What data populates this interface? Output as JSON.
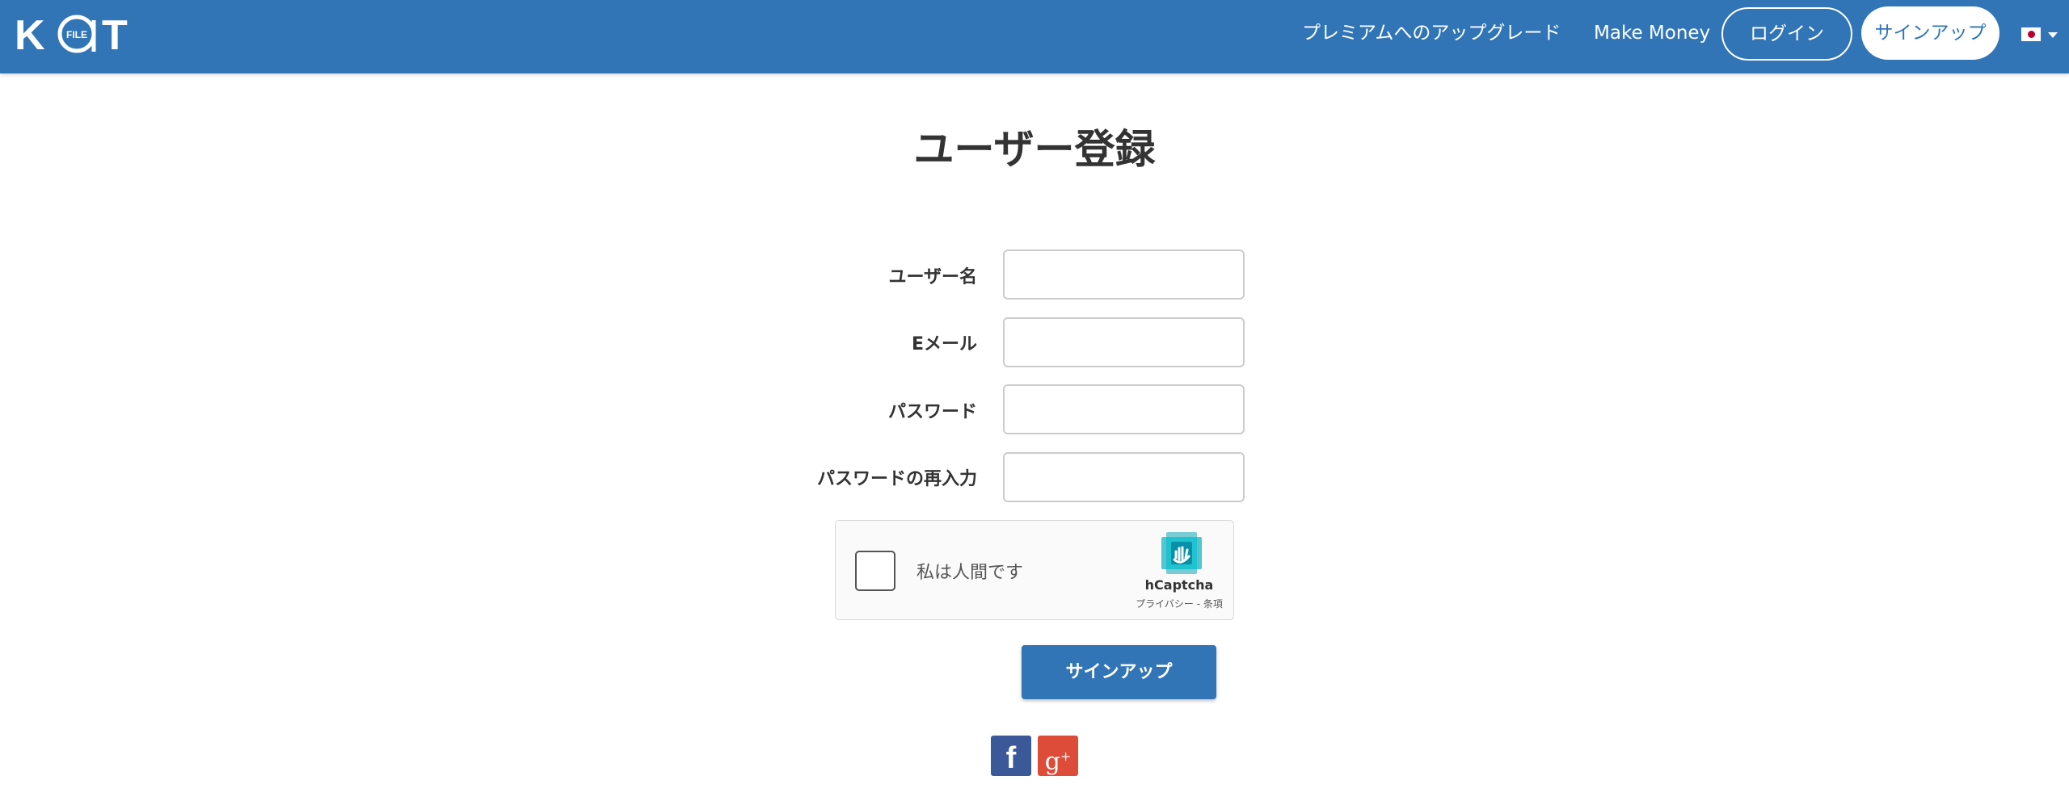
{
  "navbar": {
    "logo_letters": [
      "K",
      "FILE",
      "T"
    ],
    "upgrade_label": "プレミアムへのアップグレード",
    "make_money_label": "Make Money",
    "login_label": "ログイン",
    "signup_label": "サインアップ",
    "language_icon": "japan-flag-icon",
    "colors": {
      "bar": "#3175b7",
      "text": "#ffffff"
    }
  },
  "page": {
    "title": "ユーザー登録"
  },
  "form": {
    "fields": [
      {
        "label": "ユーザー名",
        "value": "",
        "type": "text"
      },
      {
        "label": "Eメール",
        "value": "",
        "type": "email"
      },
      {
        "label": "パスワード",
        "value": "",
        "type": "password"
      },
      {
        "label": "パスワードの再入力",
        "value": "",
        "type": "password"
      }
    ],
    "captcha": {
      "checkbox_label": "私は人間です",
      "brand": "hCaptcha",
      "links": "プライバシー - 条項",
      "checked": false
    },
    "submit_label": "サインアップ",
    "submit_color": "#3175b7"
  },
  "social": {
    "facebook_label": "f",
    "google_plus_label": "g",
    "google_plus_sup": "+",
    "colors": {
      "facebook": "#3b5998",
      "google_plus": "#dd4b39"
    }
  }
}
